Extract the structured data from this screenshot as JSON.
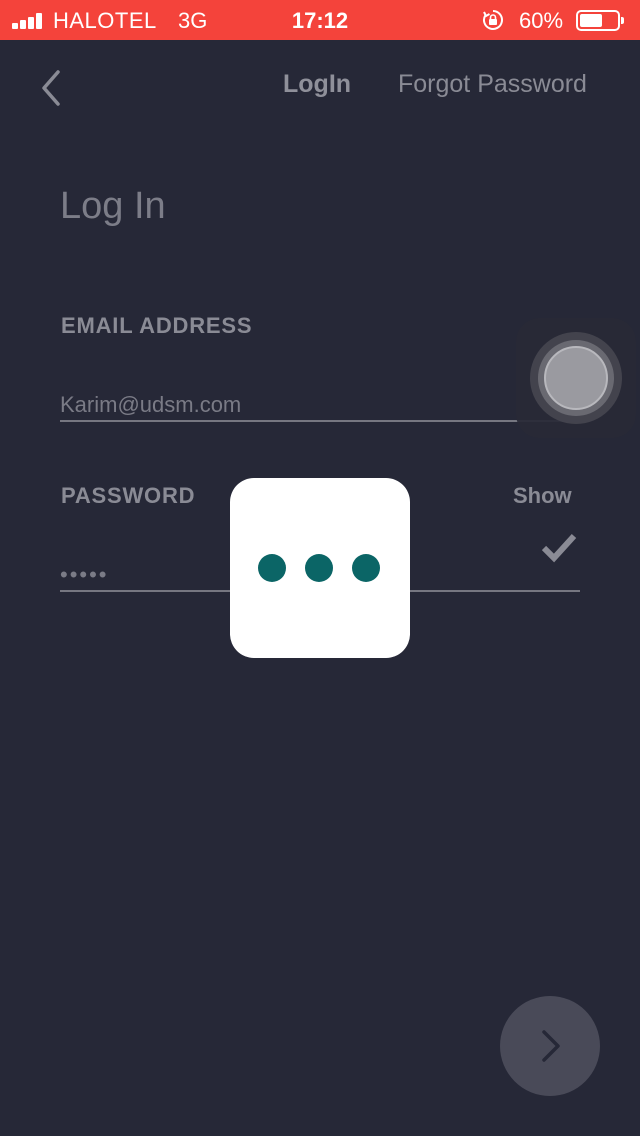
{
  "status_bar": {
    "carrier": "HALOTEL",
    "network": "3G",
    "time": "17:12",
    "battery_percent": "60%",
    "battery_level": 0.6,
    "color": "#f4433b"
  },
  "nav": {
    "back_icon": "chevron-left-icon",
    "login_label": "LogIn",
    "forgot_label": "Forgot Password"
  },
  "page": {
    "title": "Log In"
  },
  "form": {
    "email_label": "EMAIL ADDRESS",
    "email_value": "Karim@udsm.com",
    "password_label": "PASSWORD",
    "password_value": "•••••",
    "show_label": "Show"
  },
  "loading": {
    "dot_color": "#0b6566"
  },
  "colors": {
    "background": "#262837",
    "text_muted": "#8a8b95"
  }
}
